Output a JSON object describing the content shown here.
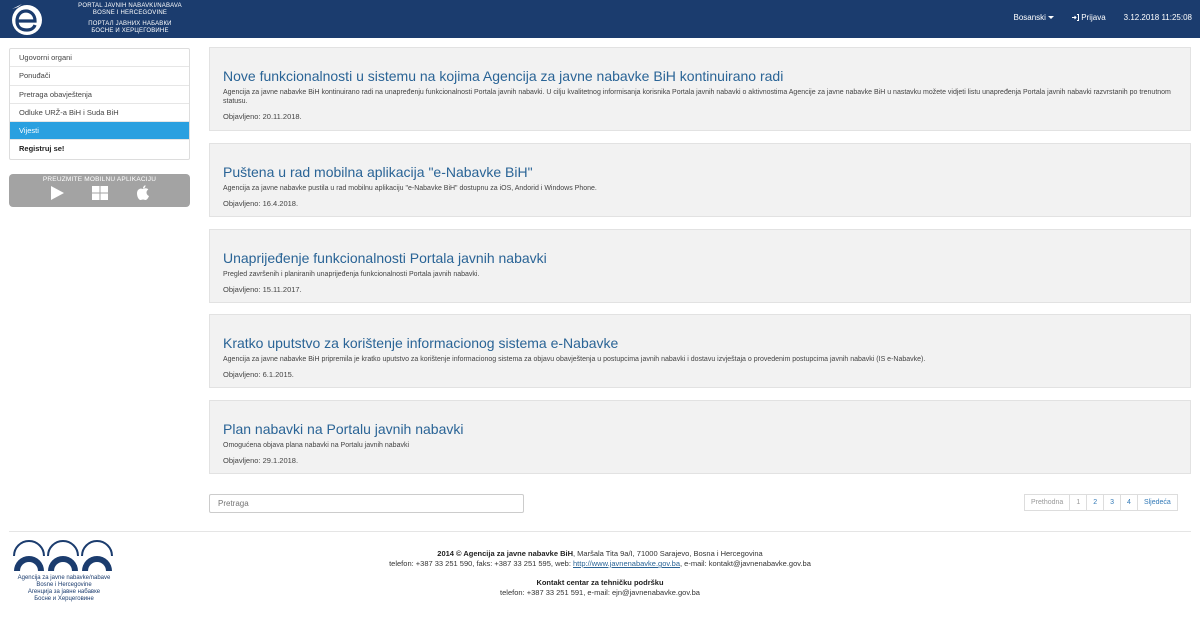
{
  "header": {
    "portal_line1": "PORTAL JAVNIH NABAVKI/NABAVA",
    "portal_line2": "BOSNE I HERCEGOVINE",
    "portal_cyr1": "ПОРТАЛ ЈАВНИХ НАБАВКИ",
    "portal_cyr2": "БОСНЕ И ХЕРЦЕГОВИНЕ",
    "language": "Bosanski",
    "login": "Prijava",
    "datetime": "3.12.2018 11:25:08"
  },
  "sidebar": {
    "items": [
      {
        "label": "Ugovorni organi"
      },
      {
        "label": "Ponuđači"
      },
      {
        "label": "Pretraga obavještenja"
      },
      {
        "label": "Odluke URŽ-a BiH i Suda BiH"
      },
      {
        "label": "Vijesti"
      },
      {
        "label": "Registruj se!"
      }
    ],
    "mobile_caption": "PREUZMITE MOBILNU APLIKACIJU",
    "store_icons": [
      "google-play-icon",
      "windows-icon",
      "apple-icon"
    ]
  },
  "news": [
    {
      "title": "Nove funkcionalnosti u sistemu na kojima Agencija za javne nabavke BiH kontinuirano radi",
      "description": "Agencija za javne nabavke BiH kontinuirano radi na unapređenju funkcionalnosti Portala javnih nabavki. U cilju kvalitetnog informisanja korisnika Portala javnih nabavki o aktivnostima Agencije za javne nabavke BiH u nastavku možete vidjeti listu unapređenja Portala javnih nabavki razvrstanih po trenutnom statusu.",
      "date": "Objavljeno: 20.11.2018."
    },
    {
      "title": "Puštena u rad mobilna aplikacija \"e-Nabavke BiH\"",
      "description": "Agencija za javne nabavke pustila u rad mobilnu aplikaciju \"e-Nabavke BiH\" dostupnu za iOS, Andorid i Windows Phone.",
      "date": "Objavljeno: 16.4.2018."
    },
    {
      "title": "Unaprijeđenje funkcionalnosti Portala javnih nabavki",
      "description": "Pregled završenih i planiranih unaprijeđenja funkcionalnosti Portala javnih nabavki.",
      "date": "Objavljeno: 15.11.2017."
    },
    {
      "title": "Kratko uputstvo za korištenje informacionog sistema e-Nabavke",
      "description": "Agencija za javne nabavke BiH pripremila je kratko uputstvo za korištenje informacionog sistema za objavu obavještenja u postupcima javnih nabavki i dostavu izvještaja o provedenim postupcima javnih nabavki (IS e-Nabavke).",
      "date": "Objavljeno: 6.1.2015."
    },
    {
      "title": "Plan nabavki na Portalu javnih nabavki",
      "description": "Omogućena objava plana nabavki na Portalu javnih nabavki",
      "date": "Objavljeno: 29.1.2018."
    }
  ],
  "search": {
    "placeholder": "Pretraga"
  },
  "pagination": {
    "prev": "Prethodna",
    "pages": [
      "1",
      "2",
      "3",
      "4"
    ],
    "next": "Sljedeća"
  },
  "footer": {
    "logo_line1": "Agencija za javne nabavke/nabave",
    "logo_line2": "Bosne i Hercegovine",
    "logo_line3": "Агенција за јавне набавке",
    "logo_line4": "Босне и Херцеговине",
    "copyright_bold": "2014 © Agencija za javne nabavke BiH",
    "address": ", Maršala Tita 9a/I, 71000 Sarajevo, Bosna i Hercegovina",
    "contact_prefix": "telefon: +387 33 251 590, faks: +387 33 251 595, web: ",
    "web_link": "http://www.javnenabavke.gov.ba",
    "contact_suffix": ", e-mail: kontakt@javnenabavke.gov.ba",
    "support_title": "Kontakt centar za tehničku podršku",
    "support_contact": "telefon: +387 33 251 591, e-mail: ejn@javnenabavke.gov.ba"
  },
  "colors": {
    "header_bg": "#1b3c6e",
    "active_item": "#2aa0e0",
    "link": "#2a6496",
    "panel_bg": "#f2f2f2"
  }
}
